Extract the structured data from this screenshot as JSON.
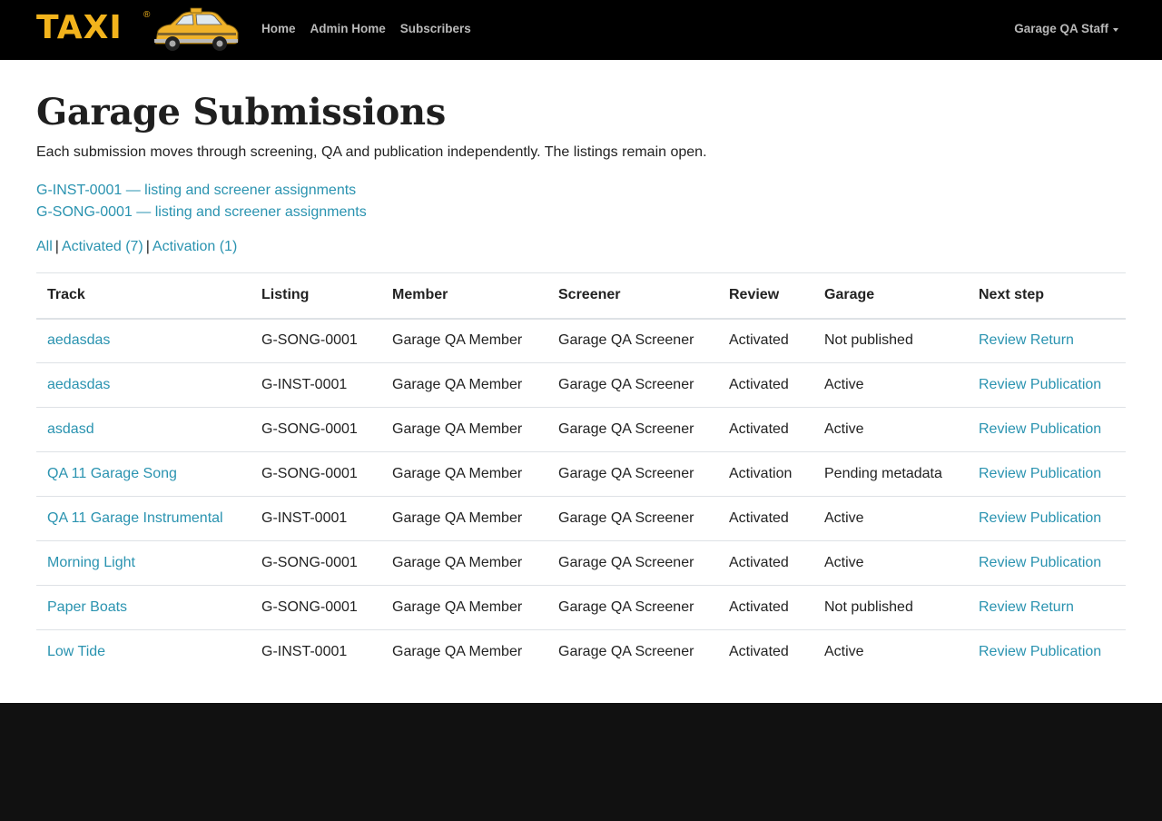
{
  "navbar": {
    "logo_text": "TAXI",
    "logo_reg": "®",
    "links": [
      "Home",
      "Admin Home",
      "Subscribers"
    ],
    "user_menu": "Garage QA Staff"
  },
  "page": {
    "title": "Garage Submissions",
    "intro": "Each submission moves through screening, QA and publication independently. The listings remain open.",
    "listing_links": [
      "G-INST-0001 — listing and screener assignments",
      "G-SONG-0001 — listing and screener assignments"
    ],
    "filters": [
      "All",
      "Activated (7)",
      "Activation (1)"
    ],
    "filter_separator": "|"
  },
  "table": {
    "headers": [
      "Track",
      "Listing",
      "Member",
      "Screener",
      "Review",
      "Garage",
      "Next step"
    ],
    "rows": [
      [
        "aedasdas",
        "G-SONG-0001",
        "Garage QA Member",
        "Garage QA Screener",
        "Activated",
        "Not published",
        "Review Return"
      ],
      [
        "aedasdas",
        "G-INST-0001",
        "Garage QA Member",
        "Garage QA Screener",
        "Activated",
        "Active",
        "Review Publication"
      ],
      [
        "asdasd",
        "G-SONG-0001",
        "Garage QA Member",
        "Garage QA Screener",
        "Activated",
        "Active",
        "Review Publication"
      ],
      [
        "QA 11 Garage Song",
        "G-SONG-0001",
        "Garage QA Member",
        "Garage QA Screener",
        "Activation",
        "Pending metadata",
        "Review Publication"
      ],
      [
        "QA 11 Garage Instrumental",
        "G-INST-0001",
        "Garage QA Member",
        "Garage QA Screener",
        "Activated",
        "Active",
        "Review Publication"
      ],
      [
        "Morning Light",
        "G-SONG-0001",
        "Garage QA Member",
        "Garage QA Screener",
        "Activated",
        "Active",
        "Review Publication"
      ],
      [
        "Paper Boats",
        "G-SONG-0001",
        "Garage QA Member",
        "Garage QA Screener",
        "Activated",
        "Not published",
        "Review Return"
      ],
      [
        "Low Tide",
        "G-INST-0001",
        "Garage QA Member",
        "Garage QA Screener",
        "Activated",
        "Active",
        "Review Publication"
      ]
    ]
  },
  "colors": {
    "navbar_bg": "#000000",
    "nav_text": "#b9b9b9",
    "logo_yellow": "#f2b31c",
    "link": "#2a93b0",
    "footer_bg": "#111111"
  },
  "icons": {
    "logo_image": "taxi-cab-icon",
    "user_menu_caret": "caret-down-icon"
  }
}
